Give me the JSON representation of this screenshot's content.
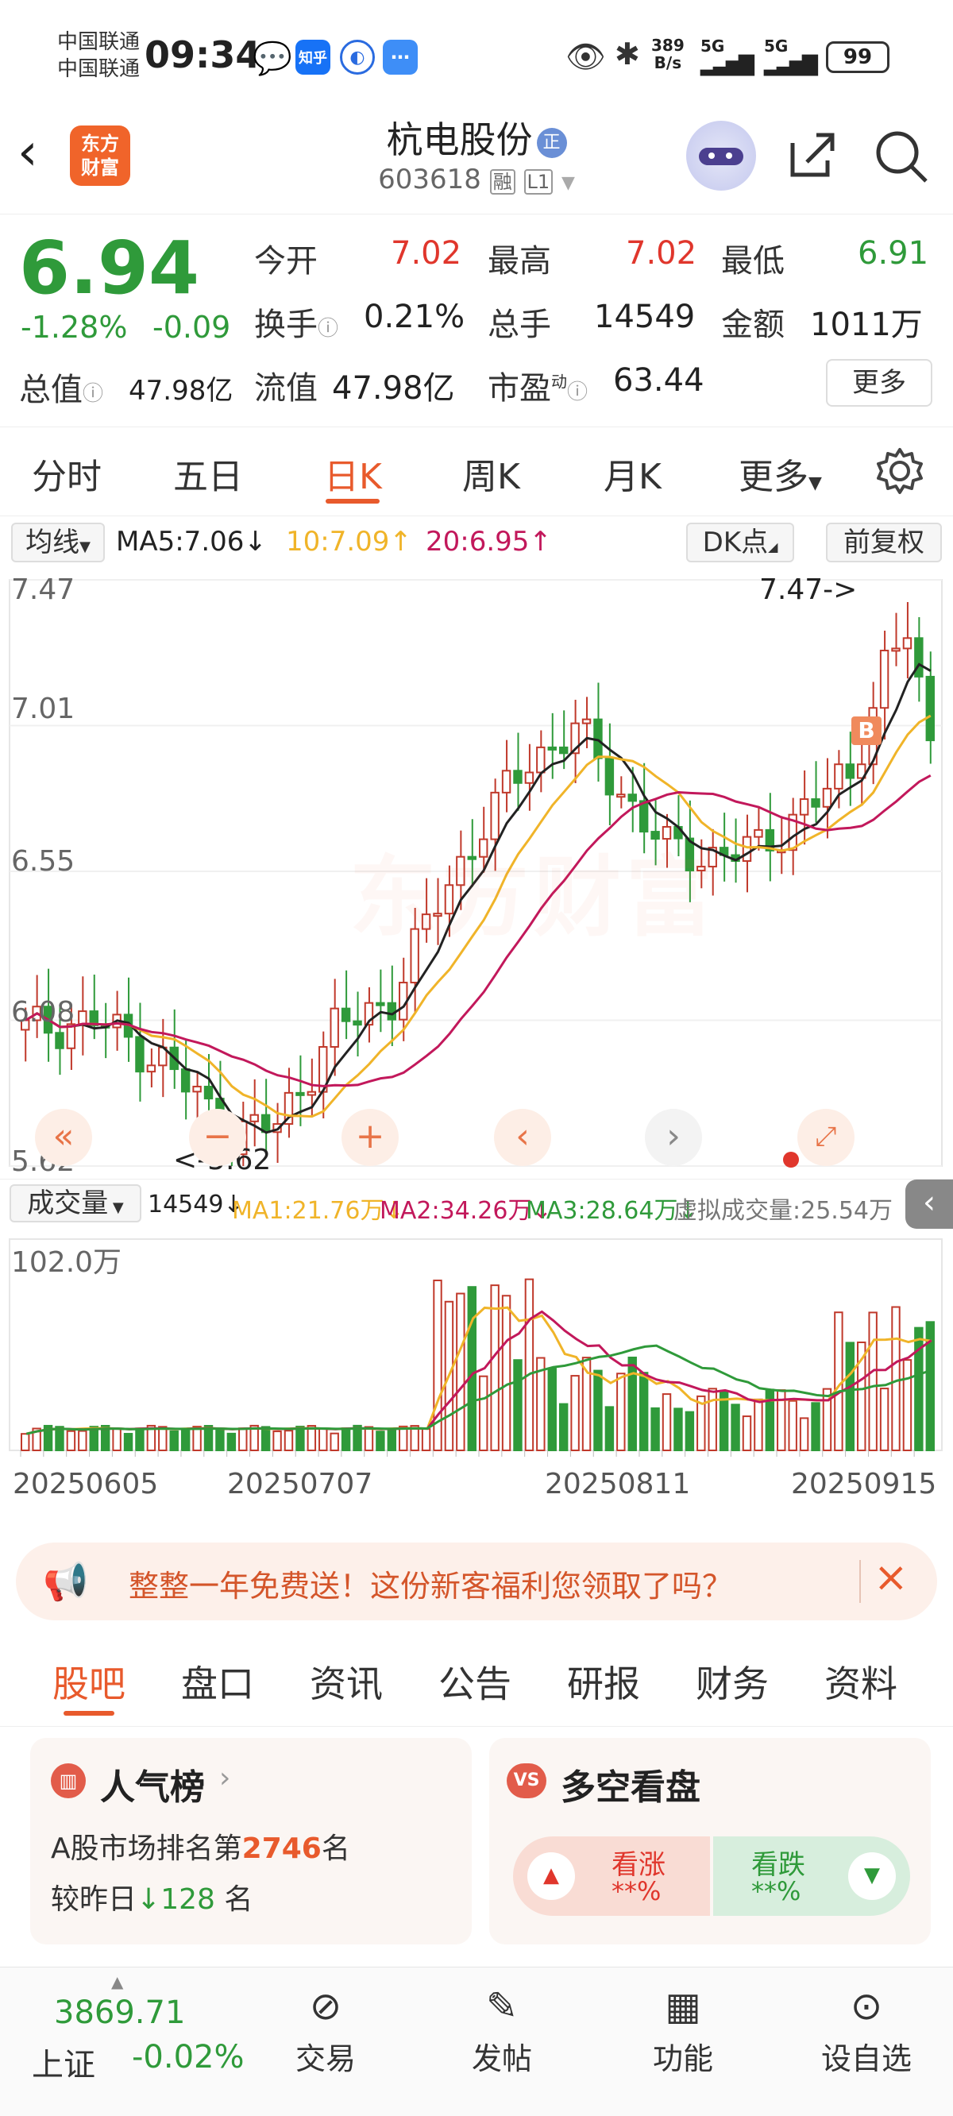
{
  "status_bar": {
    "carrier1": "中国联通",
    "carrier2": "中国联通",
    "time": "09:34",
    "app_icon_zhihu": "知乎",
    "net_speed_top": "389",
    "net_speed_bottom": "B/s",
    "net1": "5G",
    "net2": "5G",
    "battery": "99"
  },
  "header": {
    "logo_line1": "东方",
    "logo_line2": "财富",
    "stock_name": "杭电股份",
    "badge": "正",
    "code": "603618",
    "tag_margin": "融",
    "tag_level": "L1"
  },
  "quote": {
    "price": "6.94",
    "change_pct": "-1.28%",
    "change_abs": "-0.09",
    "open_label": "今开",
    "open": "7.02",
    "high_label": "最高",
    "high": "7.02",
    "low_label": "最低",
    "low": "6.91",
    "turnover_label": "换手",
    "turnover": "0.21%",
    "volume_label": "总手",
    "volume": "14549",
    "amount_label": "金额",
    "amount": "1011万",
    "mktcap_label": "总值",
    "mktcap": "47.98亿",
    "float_label": "流值",
    "float": "47.98亿",
    "pe_label": "市盈",
    "pe_sup": "动",
    "pe": "63.44",
    "more_button": "更多"
  },
  "period_tabs": [
    "分时",
    "五日",
    "日K",
    "周K",
    "月K",
    "更多"
  ],
  "kline": {
    "ma_selector": "均线",
    "ma5": "MA5:7.06↓",
    "ma10": "10:7.09↑",
    "ma20": "20:6.95↑",
    "dk_button": "DK点",
    "adjust_button": "前复权",
    "price_axis": [
      "7.47",
      "7.01",
      "6.55",
      "6.08",
      "5.62"
    ],
    "high_marker": "7.47->",
    "low_marker": "<-5.62",
    "b_marker": "B",
    "watermark": "东方财富"
  },
  "volume_panel": {
    "selector": "成交量",
    "current": "14549↓",
    "ma1": "MA1:21.76万↓",
    "ma2": "MA2:34.26万↓",
    "ma3": "MA3:28.64万↓",
    "virtual": "虚拟成交量:25.54万",
    "max_label": "102.0万",
    "dates": [
      "20250605",
      "20250707",
      "20250811",
      "20250915"
    ]
  },
  "banner": {
    "text": "整整一年免费送！这份新客福利您领取了吗？"
  },
  "bottom_tabs": [
    "股吧",
    "盘口",
    "资讯",
    "公告",
    "研报",
    "财务",
    "资料"
  ],
  "popularity": {
    "title": "人气榜",
    "rank_prefix": "A股市场排名第",
    "rank": "2746",
    "rank_suffix": "名",
    "change_prefix": "较昨日",
    "change": "128",
    "change_suffix": "名"
  },
  "sentiment": {
    "title": "多空看盘",
    "bull_label": "看涨",
    "bull_pct": "**%",
    "bear_label": "看跌",
    "bear_pct": "**%"
  },
  "bottom_nav": {
    "index_value": "3869.71",
    "index_name": "上证",
    "index_change": "-0.02%",
    "items": [
      "交易",
      "发帖",
      "功能",
      "设自选"
    ]
  },
  "chart_data": {
    "type": "candlestick",
    "dates": [
      "20250605",
      "20250707",
      "20250811",
      "20250915"
    ],
    "ylim": [
      5.62,
      7.47
    ],
    "price_ticks": [
      7.47,
      7.01,
      6.55,
      6.08,
      5.62
    ],
    "high": 7.47,
    "low": 5.62,
    "last_close": 6.94,
    "series": [
      {
        "name": "MA5",
        "last": 7.06
      },
      {
        "name": "MA10",
        "last": 7.09
      },
      {
        "name": "MA20",
        "last": 6.95
      }
    ],
    "volume": {
      "max": "102.0万",
      "last": 14549,
      "ma1": "21.76万",
      "ma2": "34.26万",
      "ma3": "28.64万"
    },
    "colors": {
      "up": "#c0392b",
      "down": "#2f9a3a",
      "ma5": "#222222",
      "ma10": "#f0b429",
      "ma20": "#c2185b",
      "ma3_vol": "#2f9a3a"
    }
  }
}
